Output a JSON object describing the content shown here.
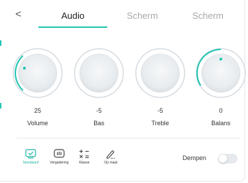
{
  "tabs": [
    {
      "label": "Audio",
      "active": true
    },
    {
      "label": "Scherm",
      "active": false
    },
    {
      "label": "Scherm",
      "active": false
    }
  ],
  "knobs": [
    {
      "value": "25",
      "label": "Volume"
    },
    {
      "value": "-5",
      "label": "Bas"
    },
    {
      "value": "-5",
      "label": "Treble"
    },
    {
      "value": "0",
      "label": "Balans"
    }
  ],
  "modes": [
    {
      "label": "Standaard",
      "icon": "check-screen-icon",
      "active": true
    },
    {
      "label": "Vergadering",
      "icon": "meeting-icon",
      "active": false
    },
    {
      "label": "Klasse",
      "icon": "class-icon",
      "active": false
    },
    {
      "label": "Op maat",
      "icon": "pen-icon",
      "active": false
    }
  ],
  "mute": {
    "label": "Dempen",
    "on": false
  },
  "colors": {
    "accent": "#22c4b4",
    "muted_tab": "#a8a8a8"
  }
}
